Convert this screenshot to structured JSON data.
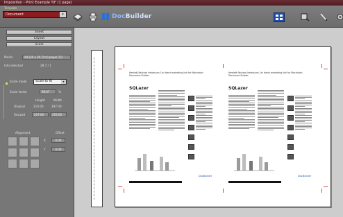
{
  "window": {
    "title": "Imposition - Print Example TIF (1 page)"
  },
  "toolbar": {
    "preset_label": "Template",
    "preset_value": "Document",
    "logo_text_a": "Doc",
    "logo_text_b": "Builder",
    "icons": [
      "stack-icon",
      "printer-icon",
      "layout-view-icon",
      "zoom-icon",
      "pen-tool-icon",
      "settings-icon"
    ]
  },
  "left_panel": {
    "tabs": [
      "Sheet",
      "Layout",
      "Scale"
    ],
    "fields": {
      "paper_label": "Media",
      "paper_value": "A4 (20 x 29.7cm) paper 1/1",
      "info_label": "Info selected",
      "info_value": "29.7 / 1"
    },
    "scale": {
      "mode_label": "Scale mode",
      "mode_value": "Scale to fit",
      "factor_label": "Scale factor",
      "factor_value": "98.67",
      "factor_unit": "%",
      "col_height": "Height",
      "col_width": "Width",
      "original_label": "Original",
      "original_height": "210.00",
      "original_width": "297.00",
      "resized_label": "Resized",
      "resized_height": "207.00",
      "resized_width": "293.00"
    },
    "alignment": {
      "label": "Alignment",
      "offset_label": "Offset",
      "x_label": "X",
      "x_value": "0.00",
      "y_label": "Y",
      "y_value": "0.00"
    }
  },
  "document": {
    "headline": "Hewlett-Packard introduces 1st direct-marketing link for Macintosh Document Builder",
    "logo": "SQLazer",
    "footer_link": "DocBuilder"
  }
}
